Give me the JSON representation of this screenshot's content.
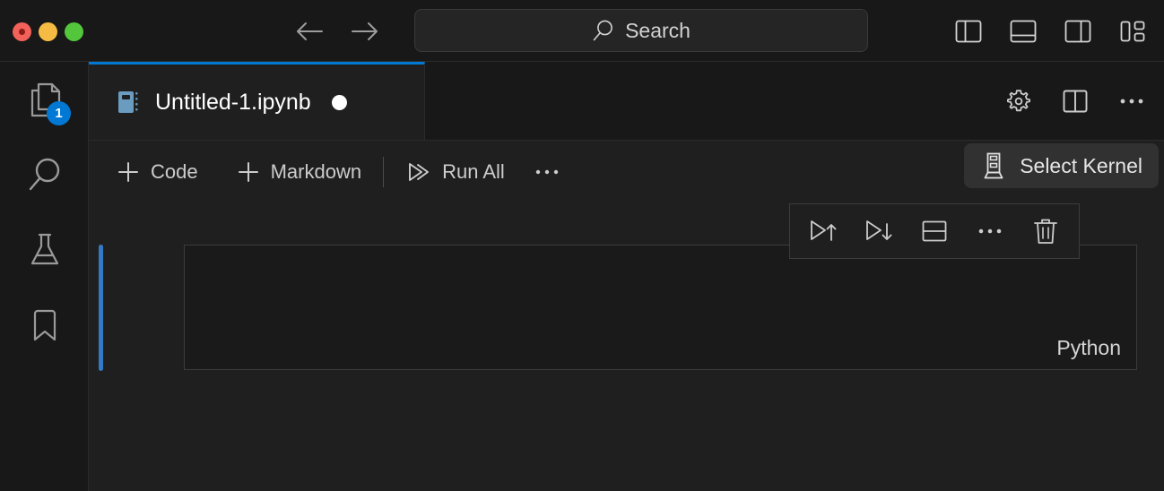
{
  "titlebar": {
    "window_controls": [
      {
        "name": "close",
        "color": "#f2615a"
      },
      {
        "name": "minimize",
        "color": "#f6bb42"
      },
      {
        "name": "maximize",
        "color": "#53c63c"
      }
    ],
    "nav": [
      {
        "name": "go-back",
        "icon": "arrow-left-icon"
      },
      {
        "name": "go-forward",
        "icon": "arrow-right-icon"
      }
    ],
    "search": {
      "label": "Search",
      "icon": "search-icon"
    },
    "layout_actions": [
      {
        "name": "toggle-primary-sidebar",
        "icon": "layout-sidebar-left-icon"
      },
      {
        "name": "toggle-panel",
        "icon": "layout-panel-bottom-icon"
      },
      {
        "name": "toggle-secondary-sidebar",
        "icon": "layout-sidebar-right-icon"
      },
      {
        "name": "customize-layout",
        "icon": "layout-customize-icon"
      }
    ]
  },
  "activitybar": {
    "items": [
      {
        "name": "explorer",
        "icon": "files-icon",
        "badge": "1",
        "active": true
      },
      {
        "name": "search",
        "icon": "search-icon",
        "badge": null,
        "active": false
      },
      {
        "name": "testing",
        "icon": "beaker-icon",
        "badge": null,
        "active": false
      },
      {
        "name": "bookmarks",
        "icon": "bookmark-icon",
        "badge": null,
        "active": false
      }
    ]
  },
  "tabbar": {
    "tabs": [
      {
        "label": "Untitled-1.ipynb",
        "icon": "notebook-icon",
        "dirty": true,
        "active": true
      }
    ],
    "actions": [
      {
        "name": "notebook-settings",
        "icon": "gear-icon"
      },
      {
        "name": "split-editor",
        "icon": "split-editor-icon"
      },
      {
        "name": "more-actions",
        "icon": "ellipsis-icon"
      }
    ]
  },
  "notebook_toolbar": {
    "add_code_label": "Code",
    "add_markdown_label": "Markdown",
    "run_all_label": "Run All",
    "more_label": "···",
    "kernel_label": "Select Kernel",
    "kernel_icon": "server-kernel-icon"
  },
  "cell_toolbar": {
    "actions": [
      {
        "name": "execute-above-cells",
        "icon": "run-above-icon"
      },
      {
        "name": "execute-cell-and-below",
        "icon": "run-below-icon"
      },
      {
        "name": "split-cell",
        "icon": "split-cell-icon"
      },
      {
        "name": "more-cell-actions",
        "icon": "ellipsis-icon"
      },
      {
        "name": "delete-cell",
        "icon": "trash-icon"
      }
    ]
  },
  "cell": {
    "run_icon": "play-icon",
    "content": "",
    "language": "Python",
    "active": true
  },
  "colors": {
    "accent": "#0078d4",
    "cell_active_bar": "#3479c5",
    "background": "#1f1f1f",
    "chrome": "#181818",
    "editor_background": "#1a1a1a",
    "border": "#2b2b2b",
    "notebook_icon": "#6a9cc0"
  }
}
